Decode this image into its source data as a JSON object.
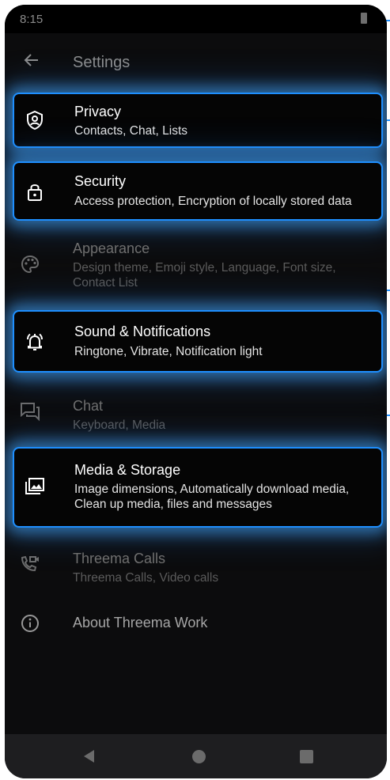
{
  "status_bar": {
    "time": "8:15"
  },
  "app_bar": {
    "title": "Settings"
  },
  "settings": [
    {
      "title": "Privacy",
      "subtitle": "Contacts, Chat, Lists",
      "icon": "shield-icon",
      "highlighted": true
    },
    {
      "title": "Security",
      "subtitle": "Access protection, Encryption of locally stored data",
      "icon": "lock-icon",
      "highlighted": true
    },
    {
      "title": "Appearance",
      "subtitle": "Design theme, Emoji style, Language, Font size, Contact List",
      "icon": "palette-icon",
      "highlighted": false
    },
    {
      "title": "Sound & Notifications",
      "subtitle": "Ringtone, Vibrate, Notification light",
      "icon": "bell-ringing-icon",
      "highlighted": true
    },
    {
      "title": "Chat",
      "subtitle": "Keyboard, Media",
      "icon": "chat-icon",
      "highlighted": false
    },
    {
      "title": "Media & Storage",
      "subtitle": "Image dimensions, Automatically download media, Clean up media, files and messages",
      "icon": "media-gallery-icon",
      "highlighted": true
    },
    {
      "title": "Threema Calls",
      "subtitle": "Threema Calls, Video calls",
      "icon": "call-video-icon",
      "highlighted": false
    },
    {
      "title": "About Threema Work",
      "subtitle": "",
      "icon": "info-icon",
      "highlighted": false
    }
  ],
  "colors": {
    "highlight_border": "#1e8fff",
    "background": "#0c0c0d"
  }
}
